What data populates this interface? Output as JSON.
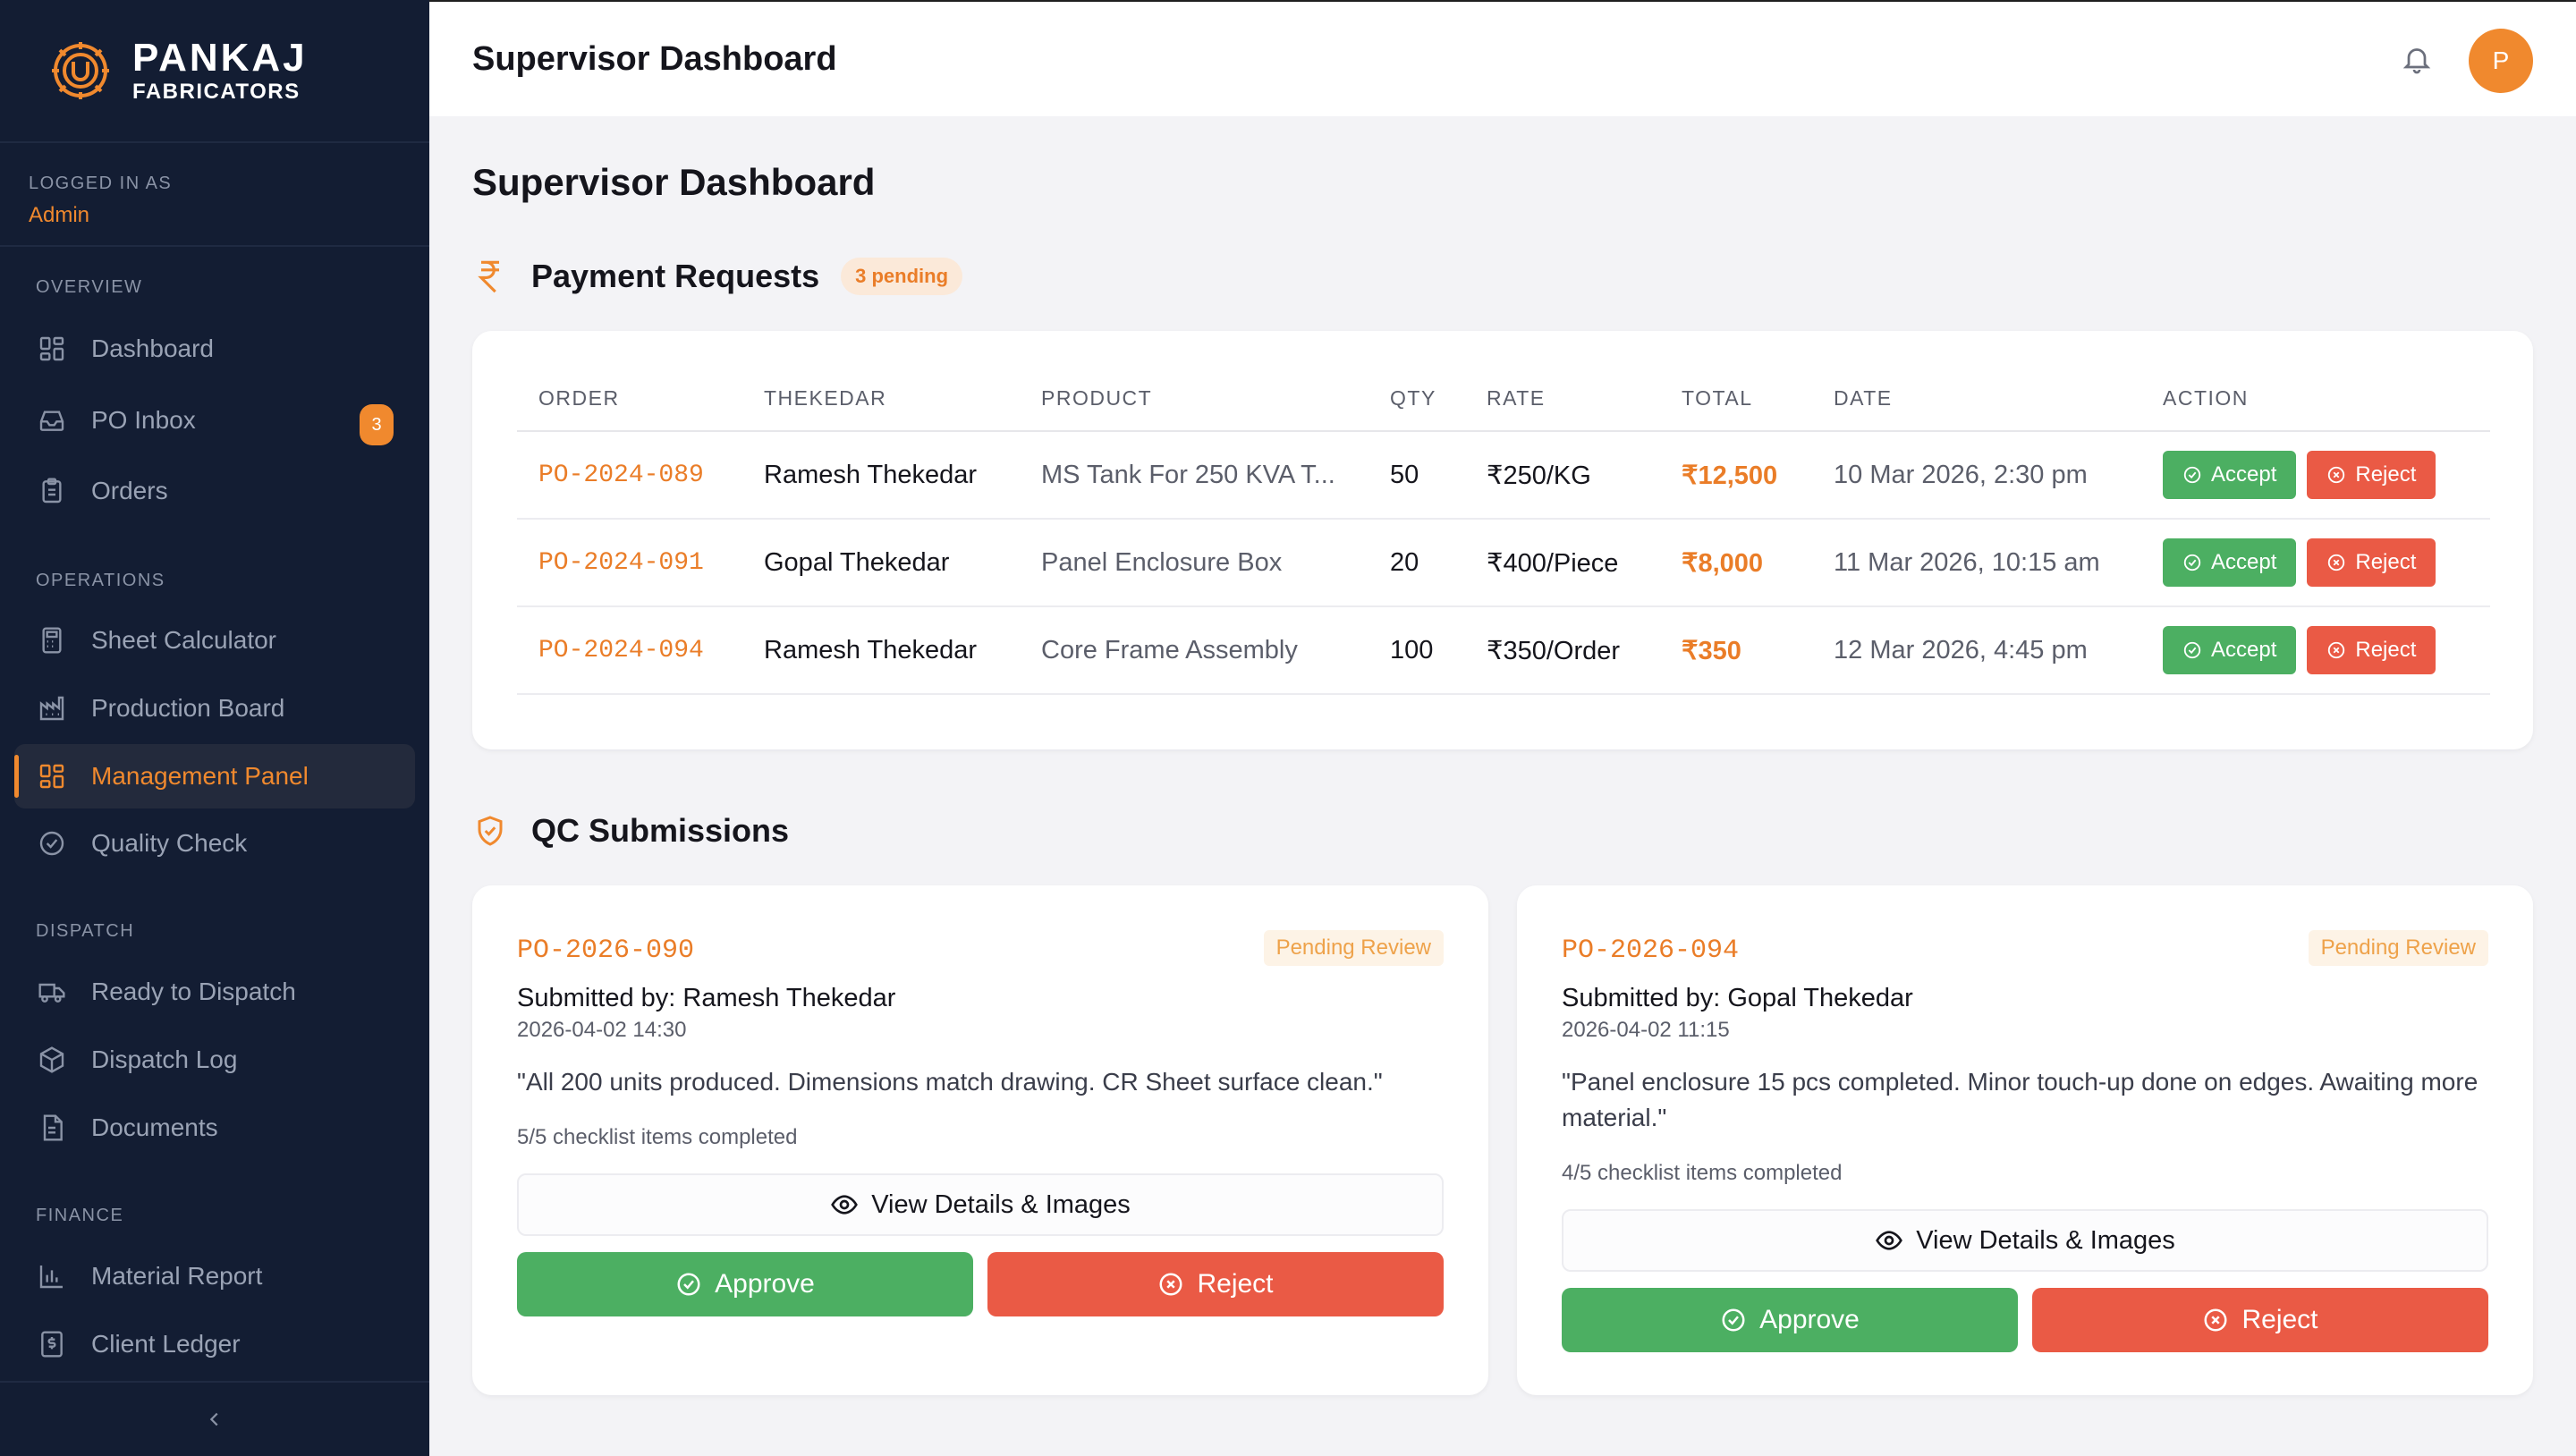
{
  "brand": {
    "name": "PANKAJ",
    "sub": "FABRICATORS"
  },
  "session": {
    "label": "LOGGED IN AS",
    "user": "Admin"
  },
  "nav": {
    "sections": {
      "overview": "OVERVIEW",
      "operations": "OPERATIONS",
      "dispatch": "DISPATCH",
      "finance": "FINANCE"
    },
    "items": [
      {
        "label": "Dashboard",
        "icon": "dashboard-icon"
      },
      {
        "label": "PO Inbox",
        "icon": "inbox-icon",
        "badge": "3"
      },
      {
        "label": "Orders",
        "icon": "clipboard-icon"
      },
      {
        "label": "Sheet Calculator",
        "icon": "calculator-icon"
      },
      {
        "label": "Production Board",
        "icon": "factory-icon"
      },
      {
        "label": "Management Panel",
        "icon": "dashboard-icon",
        "active": true
      },
      {
        "label": "Quality Check",
        "icon": "check-circle-icon"
      },
      {
        "label": "Ready to Dispatch",
        "icon": "truck-icon"
      },
      {
        "label": "Dispatch Log",
        "icon": "package-icon"
      },
      {
        "label": "Documents",
        "icon": "document-icon"
      },
      {
        "label": "Material Report",
        "icon": "bar-chart-icon"
      },
      {
        "label": "Client Ledger",
        "icon": "dollar-file-icon"
      }
    ]
  },
  "header": {
    "title": "Supervisor Dashboard",
    "avatar_initial": "P"
  },
  "page": {
    "title": "Supervisor Dashboard"
  },
  "payments": {
    "title": "Payment Requests",
    "pending": "3 pending",
    "columns": [
      "ORDER",
      "THEKEDAR",
      "PRODUCT",
      "QTY",
      "RATE",
      "TOTAL",
      "DATE",
      "ACTION"
    ],
    "accept_label": "Accept",
    "reject_label": "Reject",
    "rows": [
      {
        "order": "PO-2024-089",
        "thekedar": "Ramesh Thekedar",
        "product": "MS Tank For 250 KVA T...",
        "qty": "50",
        "rate": "₹250/KG",
        "total": "₹12,500",
        "date": "10 Mar 2026, 2:30 pm"
      },
      {
        "order": "PO-2024-091",
        "thekedar": "Gopal Thekedar",
        "product": "Panel Enclosure Box",
        "qty": "20",
        "rate": "₹400/Piece",
        "total": "₹8,000",
        "date": "11 Mar 2026, 10:15 am"
      },
      {
        "order": "PO-2024-094",
        "thekedar": "Ramesh Thekedar",
        "product": "Core Frame Assembly",
        "qty": "100",
        "rate": "₹350/Order",
        "total": "₹350",
        "date": "12 Mar 2026, 4:45 pm"
      }
    ]
  },
  "qc": {
    "title": "QC Submissions",
    "view_label": "View Details & Images",
    "approve_label": "Approve",
    "reject_label": "Reject",
    "cards": [
      {
        "po": "PO-2026-090",
        "status": "Pending Review",
        "submitted": "Submitted by: Ramesh Thekedar",
        "time": "2026-04-02 14:30",
        "note": "\"All 200 units produced. Dimensions match drawing. CR Sheet surface clean.\"",
        "checklist": "5/5 checklist items completed"
      },
      {
        "po": "PO-2026-094",
        "status": "Pending Review",
        "submitted": "Submitted by: Gopal Thekedar",
        "time": "2026-04-02 11:15",
        "note": "\"Panel enclosure 15 pcs completed. Minor touch-up done on edges. Awaiting more material.\"",
        "checklist": "4/5 checklist items completed"
      }
    ]
  },
  "colors": {
    "accent": "#f0892e",
    "sidebar": "#131d33",
    "accept": "#4caf62",
    "reject": "#ea5a45"
  }
}
